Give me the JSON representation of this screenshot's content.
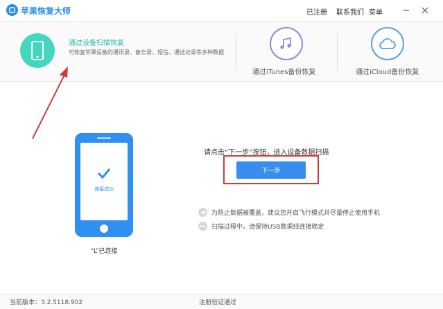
{
  "app": {
    "title": "苹果恢复大师",
    "links": [
      "已注册",
      "联系我们",
      "菜单"
    ]
  },
  "modes": [
    {
      "title": "通过设备扫描恢复",
      "description": "可恢复苹果设备的通讯录、备忘录、短信、通话记录等多种数据",
      "icon": "phone-icon",
      "active": true
    },
    {
      "title": "通过iTunes备份恢复",
      "icon": "music-note-icon",
      "active": false
    },
    {
      "title": "通过iCloud备份恢复",
      "icon": "cloud-icon",
      "active": false
    }
  ],
  "device": {
    "screen_text": "连接成功",
    "status": "“L”已连接"
  },
  "main": {
    "instruction": "请点击“下一步”按钮，进入设备数据扫描",
    "next_button": "下一步",
    "tips": [
      {
        "icon": "airplane-icon",
        "text": "为防止数据被覆盖，建议您开启飞行模式并尽量停止使用手机"
      },
      {
        "icon": "usb-icon",
        "text": "扫描过程中，请保持USB数据线连接稳定"
      }
    ]
  },
  "statusbar": {
    "version": "当前版本：3.2.5118.902",
    "registration": "注册验证通过"
  },
  "colors": {
    "accent": "#2a8fe6",
    "teal": "#45d6c0",
    "button": "#3a8df0",
    "highlight": "#d23a3a"
  }
}
